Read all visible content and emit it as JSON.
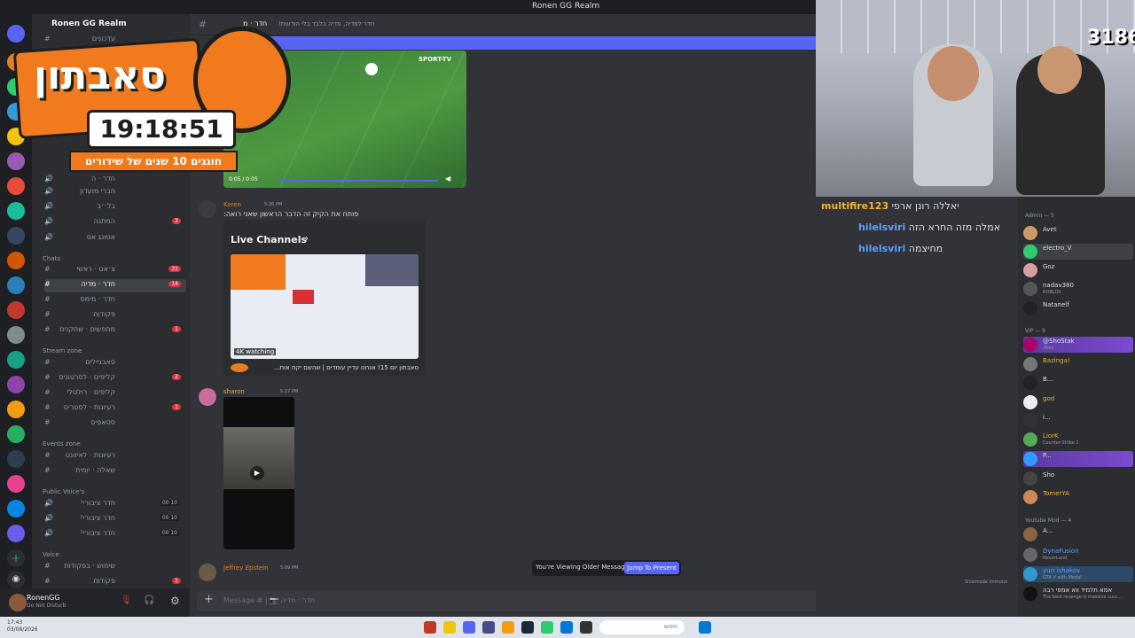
{
  "window": {
    "title": "Ronen GG Realm"
  },
  "server": {
    "name": "Ronen GG Realm"
  },
  "overlay": {
    "logo_text": "סאבתון",
    "timer": "19:18:51",
    "tagline": "חוגגים 10 שנים של שידורים"
  },
  "channel_header": {
    "name": "חדר · מ",
    "topic": "חדר לפדיה, מדיה בלבד בלי הודעות!"
  },
  "categories": {
    "chats": "Chats",
    "stream_zone": "Stream zone",
    "events_zone": "Events zone",
    "public_voice": "Public Voice's",
    "voice": "Voice"
  },
  "channels": [
    {
      "name": "עדכונים",
      "badge": ""
    },
    {
      "name": "חדר · ה",
      "badge": ""
    },
    {
      "name": "חברי מועדון",
      "badge": ""
    },
    {
      "name": "בל׳׳ב",
      "badge": ""
    },
    {
      "name": "המתנה",
      "badge": "3"
    },
    {
      "name": "אטונג אס",
      "badge": ""
    },
    {
      "name": "צ׳אט · ראשי",
      "badge": "31"
    },
    {
      "name": "חדר · מדיה",
      "badge": "14"
    },
    {
      "name": "חדר · מימס",
      "badge": ""
    },
    {
      "name": "פקודות",
      "badge": ""
    },
    {
      "name": "מחפשים · שחקנים",
      "badge": "1"
    },
    {
      "name": "סאבגיילים",
      "badge": ""
    },
    {
      "name": "קליפים · לסרטונים",
      "badge": "2"
    },
    {
      "name": "קליפים · רולטלי",
      "badge": ""
    },
    {
      "name": "רעיונות · לסטרים",
      "badge": "1"
    },
    {
      "name": "סטאפים",
      "badge": ""
    },
    {
      "name": "רעיונות · לאיוונט",
      "badge": ""
    },
    {
      "name": "שאלה · יומית",
      "badge": ""
    },
    {
      "name": "חדר ציבורי¹",
      "badge": ""
    },
    {
      "name": "חדר ציבורי²",
      "badge": ""
    },
    {
      "name": "חדר ציבורי³",
      "badge": ""
    },
    {
      "name": "שימוש · בפקודות",
      "badge": ""
    },
    {
      "name": "פקודות",
      "badge": "1"
    }
  ],
  "voice_counts": [
    "00 10",
    "00 10",
    "00 10"
  ],
  "user": {
    "name": "RonenGG",
    "status": "Do Not Disturb"
  },
  "messages": [
    {
      "author": "Koren",
      "time": "5:26 PM",
      "text": "פותח את הקיק זה הדבר הראשון שאני רואה:"
    },
    {
      "author": "sharon",
      "time": "5:27 PM",
      "text": ""
    },
    {
      "author": "Jeffrey Epstein",
      "time": "5:09 PM",
      "text": ""
    }
  ],
  "video": {
    "time": "0:05 / 0:05",
    "source": "SPORT-TV"
  },
  "embed": {
    "title": "Live Channels",
    "watching": "4K watching",
    "caption": "סאבתון יום 15! אנחנו עדיין עומדים | שהשם יקח אות..."
  },
  "viewing_bar": {
    "text": "You're Viewing Older Messages",
    "button": "Jump To Present"
  },
  "composer": {
    "placeholder": "Message # | 📷 חדר · מדיה"
  },
  "twitch_chat": [
    {
      "user": "multifire123",
      "msg": "יאללה רונן ארפי"
    },
    {
      "user": "hilelsviri",
      "msg": "אמלה מזה החרא הזה"
    },
    {
      "user": "hilelsviri",
      "msg": "מחיצמה"
    }
  ],
  "webcam": {
    "counter": "3186"
  },
  "members": {
    "admin_label": "Admin — 5",
    "admins": [
      {
        "name": "Avet",
        "sub": ""
      },
      {
        "name": "electro_V",
        "sub": ""
      },
      {
        "name": "Goz",
        "sub": ""
      },
      {
        "name": "nadav380",
        "sub": "ROBLOX"
      },
      {
        "name": "Natanelf",
        "sub": ""
      }
    ],
    "vip_label": "VIP — 9",
    "vips": [
      {
        "name": "@ShoStak",
        "sub": "2Key"
      },
      {
        "name": "Bazinga!",
        "sub": ""
      },
      {
        "name": "B...",
        "sub": ""
      },
      {
        "name": "god",
        "sub": ""
      },
      {
        "name": "i...",
        "sub": ""
      },
      {
        "name": "LiorK",
        "sub": "Counter-Strike 2"
      },
      {
        "name": "P...",
        "sub": ""
      },
      {
        "name": "Sho",
        "sub": ""
      },
      {
        "name": "TomerYA",
        "sub": ""
      }
    ],
    "ytmod_label": "Youtube Mod — 4",
    "ytmods": [
      {
        "name": "A...",
        "sub": ""
      },
      {
        "name": "DynaFusion",
        "sub": "NeverLand"
      },
      {
        "name": "yuri ishakov",
        "sub": "GTA V with Medal"
      },
      {
        "name": "אמא תלמיד ווא אמפי רבה",
        "sub": "The best revenge is massive succ..."
      }
    ],
    "slowmode": "Slowmode immune"
  },
  "taskbar": {
    "time": "17:43",
    "date": "03/08/2026",
    "search": "חיפוש"
  },
  "colors": {
    "accent": "#5865f2",
    "badge": "#da373c",
    "twitch_name": "#5aa0ff"
  }
}
